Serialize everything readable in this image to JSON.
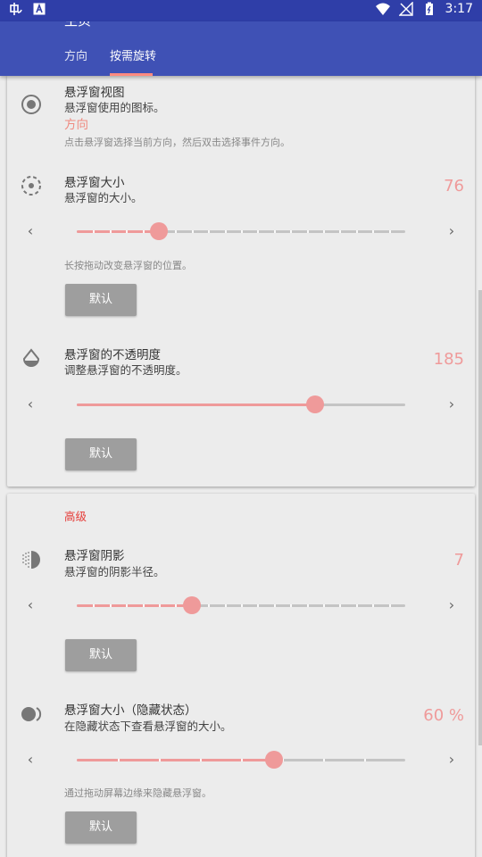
{
  "status_bar": {
    "time": "3:17",
    "left_icons": [
      "app-notification-icon",
      "a-notification-icon"
    ],
    "right_icons": [
      "wifi-icon",
      "signal-icon",
      "battery-icon"
    ]
  },
  "app_bar": {
    "title": "主页",
    "tabs": [
      {
        "label": "方向",
        "selected": false
      },
      {
        "label": "按需旋转",
        "selected": true
      }
    ],
    "colors": {
      "primary": "#3f51b5",
      "status": "#2f3ea8",
      "indicator": "#ff8a80"
    }
  },
  "card1": {
    "floating_view": {
      "title": "悬浮窗视图",
      "summary": "悬浮窗使用的图标。",
      "value": "方向",
      "hint": "点击悬浮窗选择当前方向，然后双击选择事件方向。",
      "icon": "radio-target-icon"
    },
    "floating_size": {
      "title": "悬浮窗大小",
      "summary": "悬浮窗的大小。",
      "value": "76",
      "slider_fraction": 0.25,
      "tick_count": 20,
      "hint": "长按拖动改变悬浮窗的位置。",
      "default_button": "默认",
      "icon": "dashed-circle-icon"
    },
    "opacity": {
      "title": "悬浮窗的不透明度",
      "summary": "调整悬浮窗的不透明度。",
      "value": "185",
      "slider_fraction": 0.725,
      "tick_count": 0,
      "default_button": "默认",
      "icon": "water-drop-icon"
    }
  },
  "card2": {
    "section_title": "高级",
    "shadow": {
      "title": "悬浮窗阴影",
      "summary": "悬浮窗的阴影半径。",
      "value": "7",
      "slider_fraction": 0.35,
      "tick_count": 20,
      "default_button": "默认",
      "icon": "shadow-circle-icon"
    },
    "hidden_size": {
      "title": "悬浮窗大小（隐藏状态）",
      "summary": "在隐藏状态下查看悬浮窗的大小。",
      "value": "60 %",
      "slider_fraction": 0.6,
      "tick_count": 8,
      "hint": "通过拖动屏幕边缘来隐藏悬浮窗。",
      "default_button": "默认",
      "icon": "half-hidden-circle-icon"
    }
  },
  "arrows": {
    "left": "‹",
    "right": "›"
  },
  "colors": {
    "accent": "#ef9a9a",
    "section": "#e53935",
    "button": "#9e9e9e"
  }
}
